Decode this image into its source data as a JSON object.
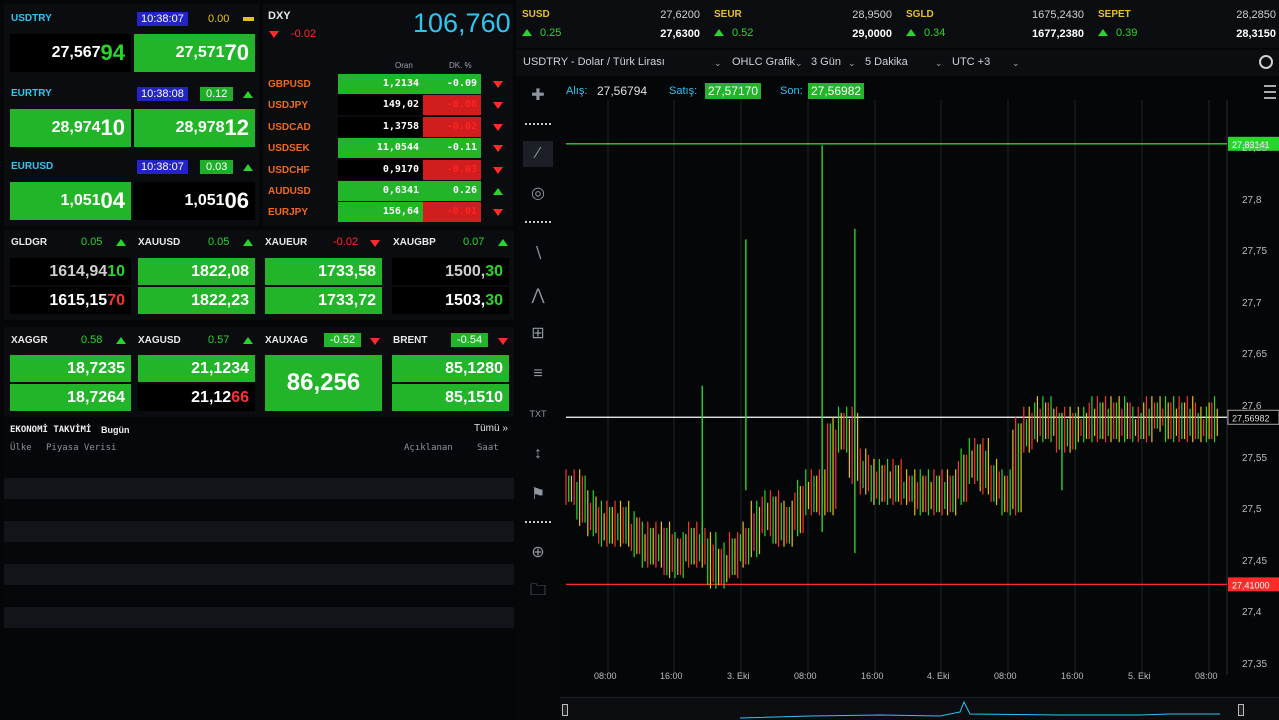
{
  "fx_tiles": [
    {
      "symbol": "USDTRY",
      "time": "10:38:07",
      "change": "0.00",
      "bid_a": "27,567",
      "bid_b": "94",
      "ask_a": "27,571",
      "ask_b": "70"
    },
    {
      "symbol": "EURTRY",
      "time": "10:38:08",
      "change": "0.12",
      "bid_a": "28,974",
      "bid_b": "10",
      "ask_a": "28,978",
      "ask_b": "12"
    },
    {
      "symbol": "EURUSD",
      "time": "10:38:07",
      "change": "0.03",
      "bid_a": "1,051",
      "bid_b": "04",
      "ask_a": "1,051",
      "ask_b": "06"
    }
  ],
  "dxy": {
    "label": "DXY",
    "value": "106,760",
    "change": "-0.02",
    "col_rate": "Oran",
    "col_pct": "DK. %"
  },
  "cross_rates": [
    {
      "pair": "GBPUSD",
      "rate": "1,2134",
      "pct": "-0.09"
    },
    {
      "pair": "USDJPY",
      "rate": "149,02",
      "pct": "-0.06"
    },
    {
      "pair": "USDCAD",
      "rate": "1,3758",
      "pct": "-0.02"
    },
    {
      "pair": "USDSEK",
      "rate": "11,0544",
      "pct": "-0.11"
    },
    {
      "pair": "USDCHF",
      "rate": "0,9170",
      "pct": "-0.03"
    },
    {
      "pair": "AUDUSD",
      "rate": "0,6341",
      "pct": "0.26"
    },
    {
      "pair": "EURJPY",
      "rate": "156,64",
      "pct": "-0.01"
    }
  ],
  "metals_row1": [
    {
      "symbol": "GLDGR",
      "change": "0.05",
      "bid_a": "1614,94",
      "bid_b": "10",
      "ask_a": "1615,15",
      "ask_b": "70"
    },
    {
      "symbol": "XAUUSD",
      "change": "0.05",
      "bid": "1822,08",
      "ask": "1822,23"
    },
    {
      "symbol": "XAUEUR",
      "change": "-0.02",
      "bid": "1733,58",
      "ask": "1733,72"
    },
    {
      "symbol": "XAUGBP",
      "change": "0.07",
      "bid_a": "1500,",
      "bid_b": "30",
      "ask_a": "1503,",
      "ask_b": "30"
    }
  ],
  "metals_row2": [
    {
      "symbol": "XAGGR",
      "change": "0.58",
      "bid": "18,7235",
      "ask": "18,7264"
    },
    {
      "symbol": "XAGUSD",
      "change": "0.57",
      "bid": "21,1234",
      "ask_a": "21,12",
      "ask_b": "66"
    },
    {
      "symbol": "XAUXAG",
      "change": "-0.52",
      "value": "86,256"
    },
    {
      "symbol": "BRENT",
      "change": "-0.54",
      "bid": "85,1280",
      "ask": "85,1510"
    }
  ],
  "calendar": {
    "title": "EKONOMİ TAKVİMİ",
    "today": "Bugün",
    "all": "Tümü »",
    "col_country": "Ülke",
    "col_data": "Piyasa Verisi",
    "col_announced": "Açıklanan",
    "col_time": "Saat"
  },
  "top_quotes": [
    {
      "name": "SUSD",
      "change": "0.25",
      "v1": "27,6200",
      "v2": "27,6300"
    },
    {
      "name": "SEUR",
      "change": "0.52",
      "v1": "28,9500",
      "v2": "29,0000"
    },
    {
      "name": "SGLD",
      "change": "0.34",
      "v1": "1675,2430",
      "v2": "1677,2380"
    },
    {
      "name": "SEPET",
      "change": "0.39",
      "v1": "28,2850",
      "v2": "28,3150"
    }
  ],
  "chart_toolbar": {
    "symbol": "USDTRY - Dolar / Türk Lirası",
    "chart_type": "OHLC Grafik",
    "range": "3 Gün",
    "interval": "5 Dakika",
    "timezone": "UTC +3"
  },
  "chart_quote": {
    "bid_label": "Alış:",
    "bid": "27,56794",
    "ask_label": "Satış:",
    "ask": "27,57170",
    "last_label": "Son:",
    "last": "27,56982"
  },
  "colors": {
    "up": "#28d62a",
    "down": "#ff2b2b",
    "accent_blue": "#2ec6f0",
    "dxy": "#2ec6f0"
  },
  "chart_data": {
    "type": "line",
    "x_ticks": [
      "08:00",
      "16:00",
      "3. Eki",
      "08:00",
      "16:00",
      "4. Eki",
      "08:00",
      "16:00",
      "5. Eki",
      "08:00"
    ],
    "y_ticks": [
      "27,85",
      "27,8",
      "27,75",
      "27,7",
      "27,65",
      "27,6",
      "27,55",
      "27,5",
      "27,45",
      "27,4",
      "27,35"
    ],
    "ylim": [
      27.33,
      27.88
    ],
    "levels": [
      {
        "value": 27.83141,
        "label": "27,83141",
        "color": "#28d62a"
      },
      {
        "value": 27.56982,
        "label": "27,56982",
        "color": "#ffffff"
      },
      {
        "value": 27.41,
        "label": "27,41000",
        "color": "#ff2b2b"
      }
    ],
    "series": [
      {
        "values": [
          27.5,
          27.48,
          27.47,
          27.46,
          27.47,
          27.46,
          27.45,
          27.44,
          27.45,
          27.43,
          27.44,
          27.45,
          27.44,
          27.42,
          27.43,
          27.44,
          27.45,
          27.47,
          27.48,
          27.46,
          27.47,
          27.49,
          27.5,
          27.49,
          27.55,
          27.56,
          27.52,
          27.51,
          27.5,
          27.51,
          27.5,
          27.5,
          27.49,
          27.5,
          27.49,
          27.5,
          27.52,
          27.53,
          27.51,
          27.5,
          27.49,
          27.55,
          27.56,
          27.57,
          27.56,
          27.55,
          27.56,
          27.56,
          27.57,
          27.56,
          27.57,
          27.56,
          27.56,
          27.57,
          27.57,
          27.56,
          27.57,
          27.56,
          27.56,
          27.57
        ]
      }
    ],
    "spikes": [
      {
        "i": 12,
        "high": 27.6,
        "low": 27.45
      },
      {
        "i": 16,
        "high": 27.74,
        "low": 27.5
      },
      {
        "i": 23,
        "high": 27.83,
        "low": 27.46
      },
      {
        "i": 26,
        "high": 27.75,
        "low": 27.44
      },
      {
        "i": 45,
        "high": 27.57,
        "low": 27.5
      }
    ]
  }
}
